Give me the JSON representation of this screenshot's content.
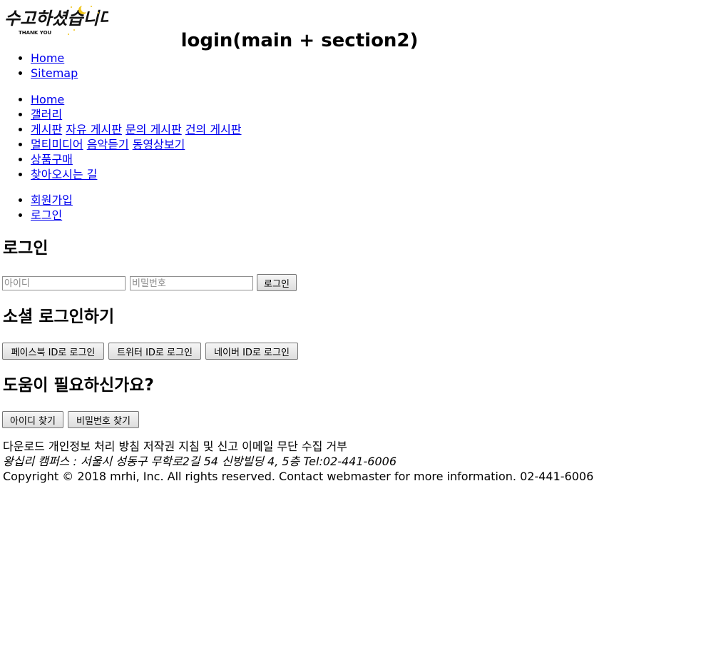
{
  "header": {
    "logo": {
      "text": "수고하셨습니다",
      "subtext": "THANK YOU",
      "icon": "crescent-moon-icon",
      "accent_color": "#f0c419"
    },
    "page_title": "login(main + section2)"
  },
  "util_nav": {
    "items": [
      {
        "label": "Home"
      },
      {
        "label": "Sitemap"
      }
    ]
  },
  "gnb": {
    "items": [
      {
        "label": "Home"
      },
      {
        "label": "갤러리"
      },
      {
        "label": "게시판",
        "sub": [
          "자유 게시판",
          "문의 게시판",
          "건의 게시판"
        ]
      },
      {
        "label": "멀티미디어",
        "sub": [
          "음악듣기",
          "동영상보기"
        ]
      },
      {
        "label": "상품구매"
      },
      {
        "label": "찾아오시는 길"
      }
    ]
  },
  "member_nav": {
    "items": [
      {
        "label": "회원가입"
      },
      {
        "label": "로그인"
      }
    ]
  },
  "login": {
    "heading": "로그인",
    "id_placeholder": "아이디",
    "id_value": "",
    "pw_placeholder": "비밀번호",
    "pw_value": "",
    "submit_label": "로그인"
  },
  "social": {
    "heading": "소셜 로그인하기",
    "facebook_label": "페이스북 ID로 로그인",
    "twitter_label": "트위터 ID로 로그인",
    "naver_label": "네이버 ID로 로그인"
  },
  "help": {
    "heading": "도움이 필요하신가요?",
    "find_id_label": "아이디 찾기",
    "find_pw_label": "비밀번호 찾기"
  },
  "footer": {
    "links": [
      "다운로드",
      "개인정보 처리 방침",
      "저작권 지침 및 신고",
      "이메일 무단 수집 거부"
    ],
    "address": "왕십리 캠퍼스 : 서울시 성동구 무학로2길 54 신방빌딩 4, 5층 Tel:02-441-6006",
    "copyright": "Copyright © 2018 mrhi, Inc. All rights reserved. Contact webmaster for more information. 02-441-6006"
  },
  "colors": {
    "link": "#0000ee",
    "text": "#000000",
    "background": "#ffffff"
  }
}
